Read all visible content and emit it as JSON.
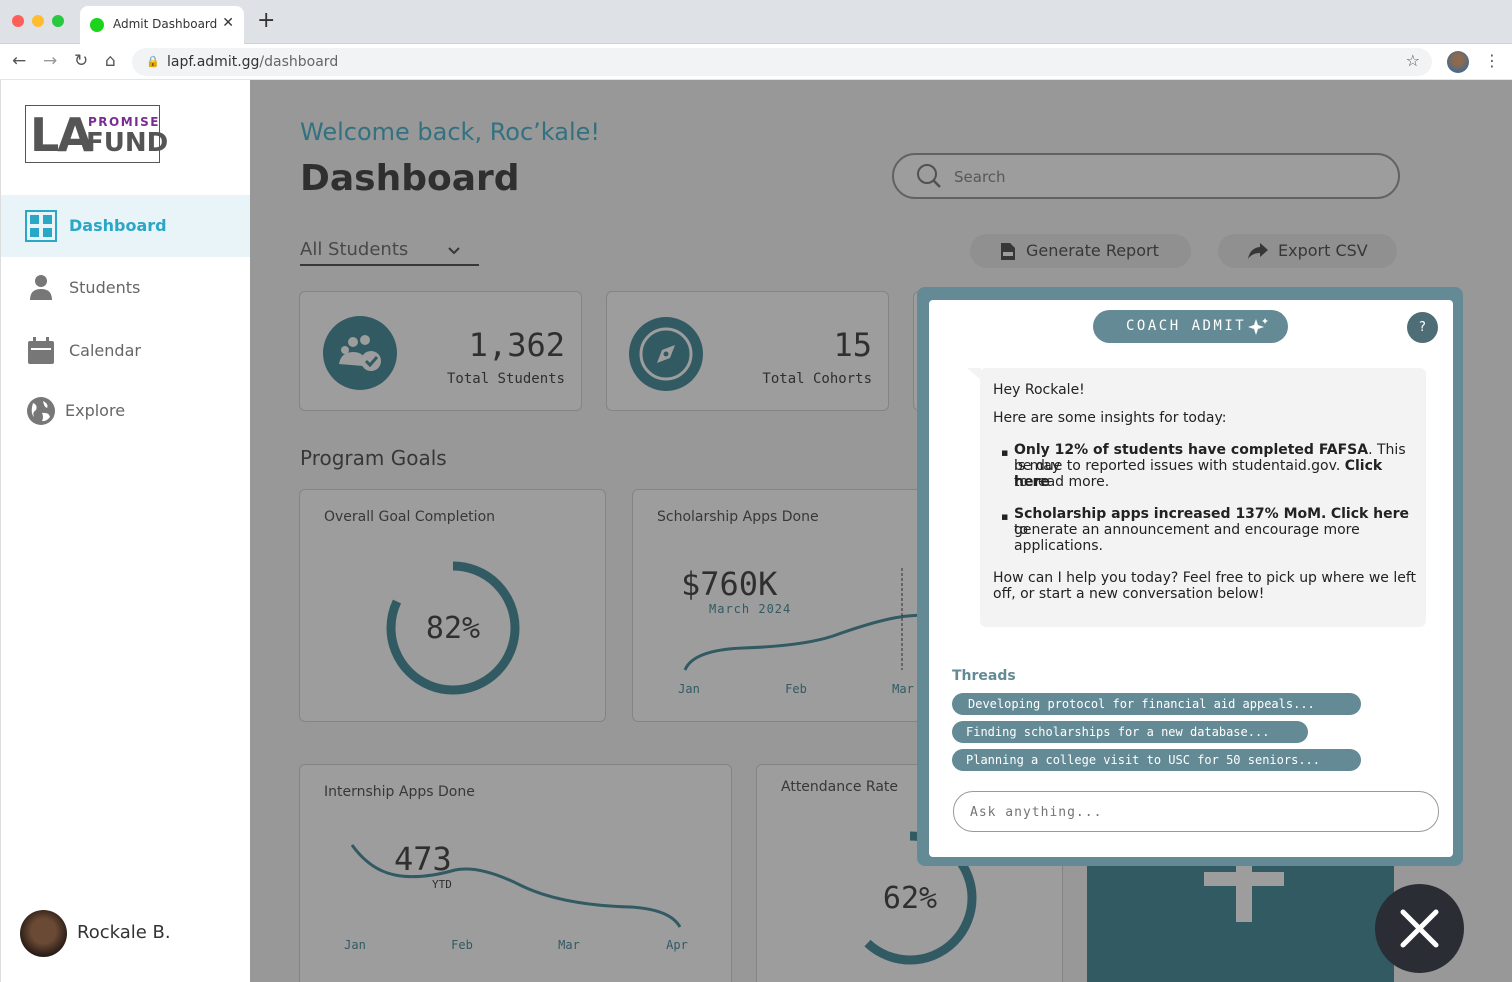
{
  "browser": {
    "tab_title": "Admit Dashboard",
    "url_host": "lapf.admit.gg",
    "url_path": "/dashboard"
  },
  "logo": {
    "la": "LA",
    "promise": "PROMISE",
    "fund": "FUND"
  },
  "sidebar": {
    "items": [
      {
        "label": "Dashboard",
        "icon": "grid-icon",
        "active": true
      },
      {
        "label": "Students",
        "icon": "person-icon"
      },
      {
        "label": "Calendar",
        "icon": "calendar-icon"
      },
      {
        "label": "Explore",
        "icon": "globe-icon"
      }
    ],
    "user_name": "Rockale B."
  },
  "header": {
    "welcome": "Welcome back, Roc’kale!",
    "title": "Dashboard",
    "search_placeholder": "Search"
  },
  "toolbar": {
    "filter_label": "All Students",
    "generate_report": "Generate Report",
    "export_csv": "Export CSV"
  },
  "stats": [
    {
      "value": "1,362",
      "label": "Total Students",
      "icon": "people-check-icon"
    },
    {
      "value": "15",
      "label": "Total Cohorts",
      "icon": "compass-icon"
    }
  ],
  "program_goals": {
    "title": "Program Goals",
    "overall": {
      "title": "Overall Goal Completion",
      "value_text": "82%",
      "value": 82
    },
    "scholarship": {
      "title": "Scholarship Apps Done",
      "amount": "$760K",
      "sub": "March 2024",
      "months": [
        "Jan",
        "Feb",
        "Mar"
      ]
    },
    "internship": {
      "title": "Internship Apps Done",
      "amount": "473",
      "sub": "YTD",
      "months": [
        "Jan",
        "Feb",
        "Mar",
        "Apr"
      ]
    },
    "attendance": {
      "title": "Attendance Rate",
      "value_text": "62%",
      "value": 62
    }
  },
  "coach": {
    "badge": "COACH ADMIT",
    "help": "?",
    "greeting": "Hey Rockale!",
    "intro": "Here are some insights for today:",
    "insight1_bold": "Only 12% of students have completed FAFSA",
    "insight1_line1_rest": ". This is may",
    "insight1_line2_plain": "be due to reported issues with studentaid.gov.",
    "insight1_link": "Click here",
    "insight1_line3": "to read more.",
    "insight2_bold": "Scholarship apps increased 137% MoM.",
    "insight2_link": "Click here",
    "insight2_rest": "to",
    "insight2_line2": "generate an announcement and encourage more",
    "insight2_line3": "applications.",
    "closing_line1": "How can I help you today? Feel free to pick up where we left",
    "closing_line2": "off, or start a new conversation below!",
    "threads_label": "Threads",
    "threads": [
      "Developing protocol for financial aid appeals...",
      "Finding scholarships for a new database...",
      "Planning a college visit to USC for 50 seniors..."
    ],
    "ask_placeholder": "Ask anything..."
  },
  "colors": {
    "accent": "#2aa7c6",
    "teal_dark": "#26788b",
    "coach": "#648a95"
  }
}
